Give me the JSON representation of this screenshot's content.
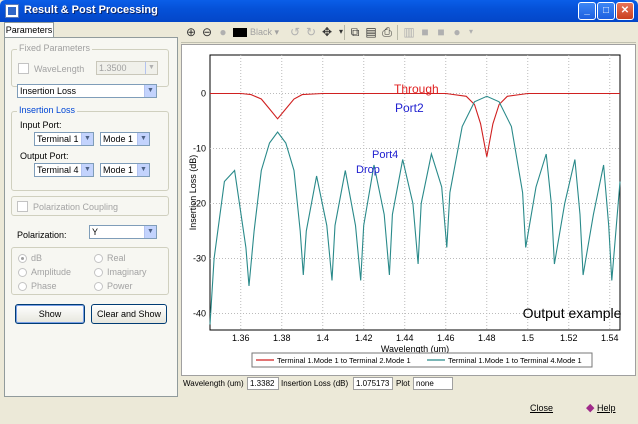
{
  "window": {
    "title": "Result & Post Processing",
    "controls": {
      "minimize": "_",
      "maximize": "□",
      "close": "✕"
    }
  },
  "tabs": [
    {
      "label": "Parameters"
    }
  ],
  "fixed_parameters": {
    "legend": "Fixed Parameters",
    "wavelength_label": "WaveLength",
    "wavelength_value": "1.3500"
  },
  "result_type": {
    "value": "Insertion Loss"
  },
  "insertion_loss": {
    "legend": "Insertion Loss",
    "input_port_label": "Input Port:",
    "input_terminal": "Terminal 1",
    "input_mode": "Mode 1",
    "output_port_label": "Output Port:",
    "output_terminal": "Terminal 4",
    "output_mode": "Mode 1"
  },
  "polarization_coupling": {
    "label": "Polarization Coupling"
  },
  "polarization": {
    "label": "Polarization:",
    "value": "Y"
  },
  "display_options": {
    "dB": "dB",
    "amplitude": "Amplitude",
    "phase": "Phase",
    "real": "Real",
    "imaginary": "Imaginary",
    "power": "Power"
  },
  "buttons": {
    "show": "Show",
    "clear_and_show": "Clear and Show",
    "close": "Close",
    "help": "Help"
  },
  "toolbar": {
    "color_label": "Black"
  },
  "status": {
    "wavelength_label": "Wavelength (um)",
    "wavelength_value": "1.3382",
    "loss_label": "Insertion Loss (dB)",
    "loss_value": "1.075173",
    "plot_label": "Plot",
    "plot_value": "none"
  },
  "chart_data": {
    "type": "line",
    "xlabel": "Wavelength (um)",
    "ylabel": "Insertion Loss (dB)",
    "xlim": [
      1.345,
      1.545
    ],
    "ylim": [
      -43,
      7
    ],
    "xticks": [
      1.36,
      1.38,
      1.4,
      1.42,
      1.44,
      1.46,
      1.48,
      1.5,
      1.52,
      1.54
    ],
    "xtick_labels": [
      "1.36",
      "1.38",
      "1.4",
      "1.42",
      "1.44",
      "1.46",
      "1.48",
      "1.5",
      "1.52",
      "1.54"
    ],
    "yticks": [
      0,
      -10,
      -20,
      -30,
      -40
    ],
    "ytick_labels": [
      "0",
      "-10",
      "-20",
      "-30",
      "-40"
    ],
    "grid": true,
    "legend_placement": "bottom",
    "annotations": [
      {
        "text": "Through",
        "color": "#e02020"
      },
      {
        "text": "Port2",
        "color": "#2020d0"
      },
      {
        "text": "Port4",
        "color": "#2020d0"
      },
      {
        "text": "Drop",
        "color": "#2020d0"
      },
      {
        "text": "Output example",
        "color": "#000000"
      }
    ],
    "series": [
      {
        "name": "Terminal 1.Mode 1 to Terminal 2.Mode 1",
        "color": "#d02020",
        "x": [
          1.345,
          1.36,
          1.365,
          1.37,
          1.374,
          1.378,
          1.382,
          1.386,
          1.39,
          1.4,
          1.42,
          1.44,
          1.46,
          1.47,
          1.474,
          1.477,
          1.48,
          1.483,
          1.486,
          1.49,
          1.5,
          1.52,
          1.545
        ],
        "y": [
          0,
          0,
          -0.2,
          -1,
          -2.8,
          -4.6,
          -2.8,
          -1,
          -0.2,
          0,
          0,
          0,
          0,
          -0.5,
          -2,
          -5.5,
          -11.5,
          -5.5,
          -2,
          -0.5,
          0,
          0,
          0
        ]
      },
      {
        "name": "Terminal 1.Mode 1 to Terminal 4.Mode 1",
        "color": "#2a8a8a",
        "x": [
          1.345,
          1.347,
          1.352,
          1.357,
          1.3625,
          1.364,
          1.3665,
          1.37,
          1.374,
          1.378,
          1.382,
          1.386,
          1.389,
          1.3905,
          1.392,
          1.397,
          1.402,
          1.4045,
          1.406,
          1.411,
          1.416,
          1.4185,
          1.42,
          1.425,
          1.43,
          1.4325,
          1.434,
          1.439,
          1.444,
          1.4465,
          1.448,
          1.453,
          1.458,
          1.4605,
          1.462,
          1.468,
          1.474,
          1.48,
          1.486,
          1.492,
          1.4975,
          1.499,
          1.504,
          1.509,
          1.5115,
          1.513,
          1.518,
          1.523,
          1.5255,
          1.527,
          1.532,
          1.537,
          1.5395,
          1.541,
          1.545
        ],
        "y": [
          -42,
          -30,
          -16,
          -14,
          -28,
          -35,
          -25,
          -14,
          -9,
          -7,
          -9,
          -14,
          -25,
          -33,
          -25,
          -15,
          -24,
          -34,
          -24,
          -14,
          -24,
          -34,
          -24,
          -13,
          -22,
          -33,
          -22,
          -12,
          -20,
          -31,
          -20,
          -11,
          -17,
          -28,
          -18,
          -6,
          -1.5,
          -0.5,
          -1.5,
          -6,
          -18,
          -28,
          -17,
          -11,
          -20,
          -31,
          -20,
          -12,
          -22,
          -33,
          -22,
          -13,
          -24,
          -34,
          -16
        ]
      }
    ]
  }
}
